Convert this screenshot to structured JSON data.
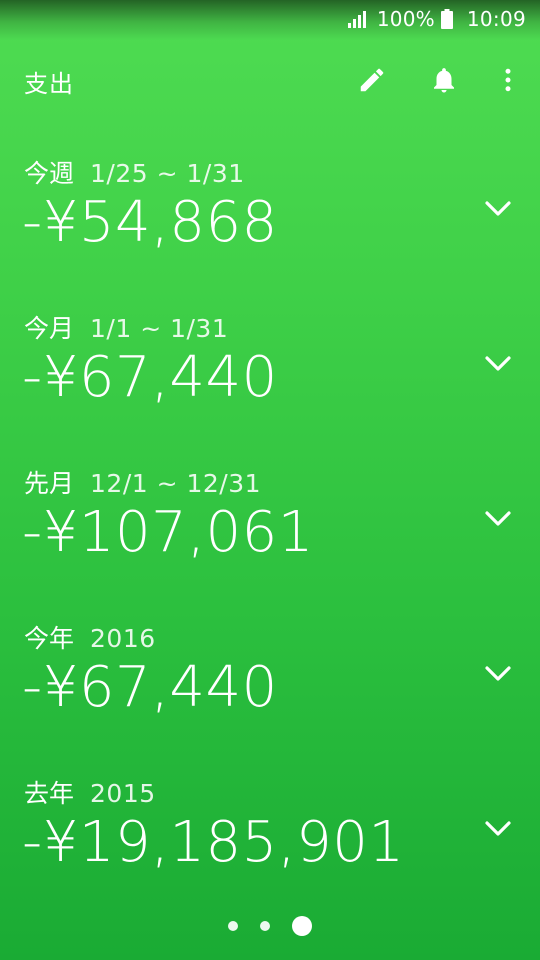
{
  "status_bar": {
    "battery_percent": "100%",
    "time": "10:09",
    "icons": [
      "signal-icon",
      "battery-icon"
    ]
  },
  "app_bar": {
    "title": "支出",
    "actions": [
      "edit-icon",
      "bell-icon",
      "more-vert-icon"
    ]
  },
  "summaries": [
    {
      "period": "今週",
      "range": "1/25 ~ 1/31",
      "amount": "-¥54,868"
    },
    {
      "period": "今月",
      "range": "1/1 ~ 1/31",
      "amount": "-¥67,440"
    },
    {
      "period": "先月",
      "range": "12/1 ~ 12/31",
      "amount": "-¥107,061"
    },
    {
      "period": "今年",
      "range": "2016",
      "amount": "-¥67,440"
    },
    {
      "period": "去年",
      "range": "2015",
      "amount": "-¥19,185,901"
    }
  ],
  "pager": {
    "page_count": 3,
    "current_page": 3
  },
  "colors": {
    "background_top": "#4fdc52",
    "background_bottom": "#1aab34",
    "foreground": "#ffffff"
  }
}
